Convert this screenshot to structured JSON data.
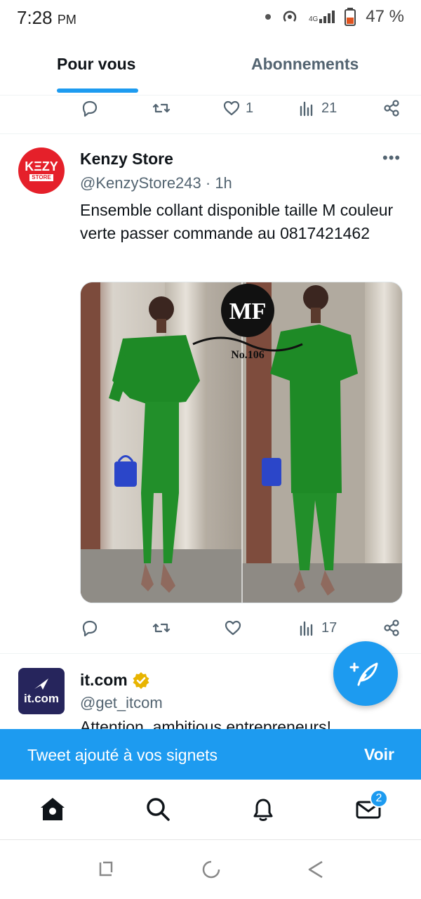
{
  "status_bar": {
    "time": "7:28",
    "ampm": "PM",
    "network": "4G",
    "battery": "47 %"
  },
  "tabs": [
    {
      "label": "Pour vous",
      "active": true
    },
    {
      "label": "Abonnements",
      "active": false
    }
  ],
  "prev_tweet_actions": {
    "like_count": "1",
    "views_count": "21"
  },
  "tweet": {
    "author_name": "Kenzy Store",
    "avatar_text": "ΚΞΖΥ",
    "avatar_sub": "STORE",
    "handle_time": "@KenzyStore243 · 1h",
    "text": "Ensemble collant disponible taille M couleur verte passer commande au 0817421462",
    "media_watermark": "MF",
    "media_watermark_sub": "No.106",
    "views_count": "17"
  },
  "next_tweet": {
    "author_name": "it.com",
    "avatar_text": "it.com",
    "handle": "@get_itcom",
    "text": "Attention, ambitious entrepreneurs!"
  },
  "snackbar": {
    "message": "Tweet ajouté à vos signets",
    "action": "Voir"
  },
  "bottom_nav": {
    "messages_badge": "2"
  },
  "colors": {
    "accent": "#1d9bf0",
    "text_primary": "#0f1419",
    "text_secondary": "#536471",
    "kenzy_red": "#e5202a",
    "itcom_navy": "#26255c",
    "verified_gold": "#e8b400"
  }
}
